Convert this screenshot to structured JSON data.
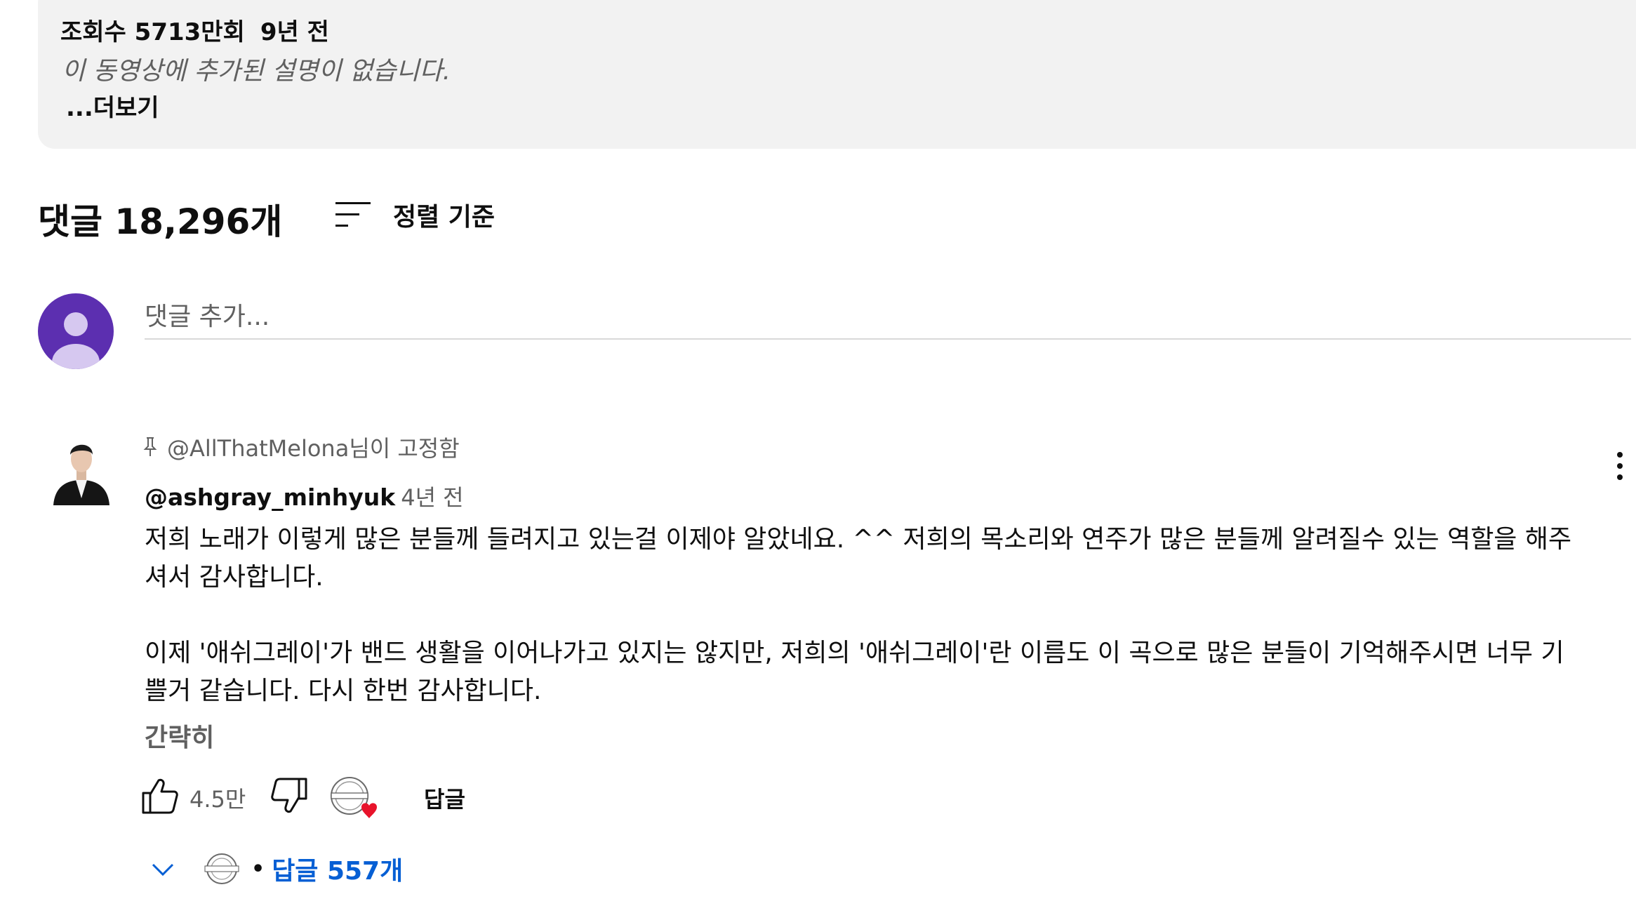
{
  "description": {
    "views": "조회수 5713만회",
    "age": "9년 전",
    "empty_text": "이 동영상에 추가된 설명이 없습니다.",
    "more_label": "...더보기"
  },
  "comments": {
    "count_label": "댓글 18,296개",
    "sort_label": "정렬 기준",
    "add_placeholder": "댓글 추가...",
    "pinned": {
      "pinned_by": "@AllThatMelona님이 고정함",
      "author": "@ashgray_minhyuk",
      "time": "4년 전",
      "paragraphs": [
        "저희 노래가 이렇게 많은 분들께 들려지고 있는걸 이제야 알았네요. ^^ 저희의 목소리와 연주가 많은 분들께 알려질수 있는 역할을 해주셔서 감사합니다.",
        "이제 '애쉬그레이'가 밴드 생활을 이어나가고 있지는 않지만, 저희의 '애쉬그레이'란 이름도 이 곡으로 많은 분들이 기억해주시면 너무 기쁠거 같습니다. 다시 한번 감사합니다."
      ],
      "collapse_label": "간략히",
      "like_count": "4.5만",
      "reply_label": "답글",
      "replies_label": "답글 557개"
    }
  },
  "icons": {
    "sort": "sort-icon",
    "pin": "pin-icon",
    "like": "thumbs-up-icon",
    "dislike": "thumbs-down-icon",
    "heart": "creator-heart-icon",
    "more": "more-vert-icon",
    "chevron": "chevron-down-icon"
  },
  "colors": {
    "description_bg": "#f2f2f2",
    "avatar_bg": "#5c2fb0",
    "link_blue": "#065fd4",
    "secondary_text": "#606060",
    "heart_red": "#e8132b"
  }
}
